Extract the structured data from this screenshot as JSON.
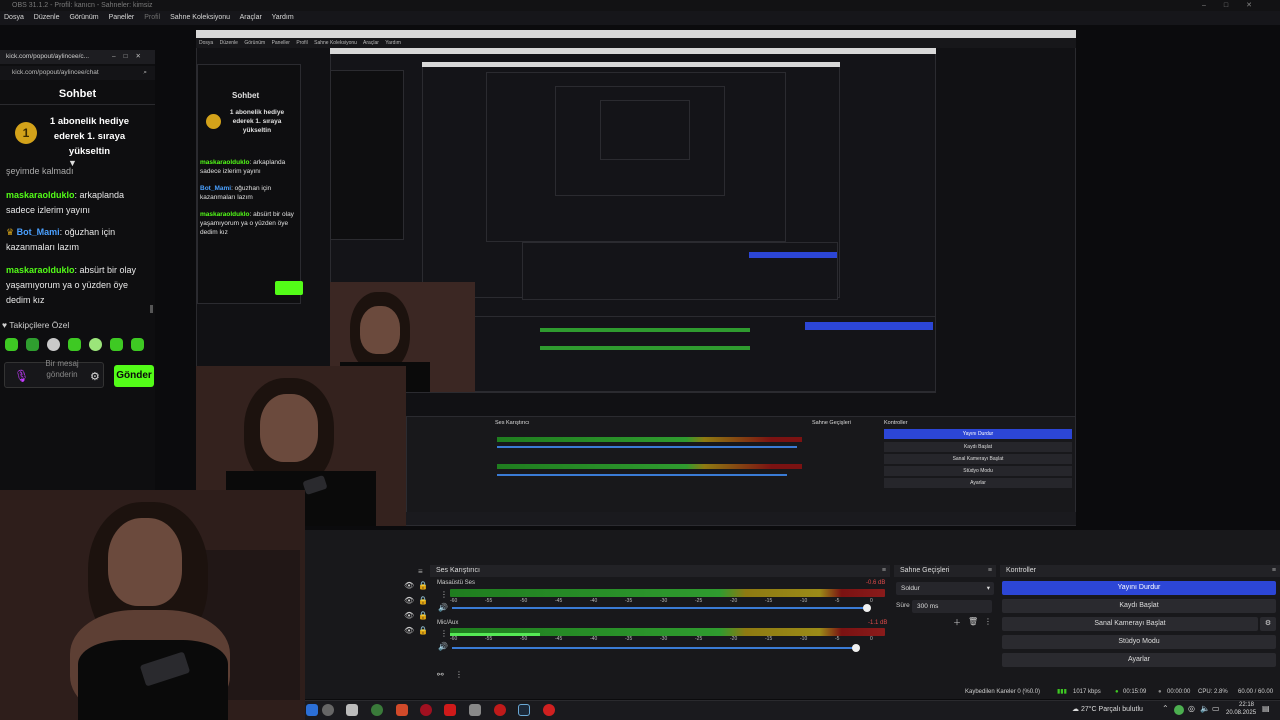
{
  "obs": {
    "title": "OBS 31.1.2 - Profil: kanıcn - Sahneler: kimsiz",
    "menu": [
      "Dosya",
      "Düzenle",
      "Görünüm",
      "Paneller",
      "Profil",
      "Sahne Koleksiyonu",
      "Araçlar",
      "Yardım"
    ]
  },
  "chat": {
    "window_url": "kick.com/popout/aylincee/c...",
    "address": "kick.com/popout/aylincee/chat",
    "title": "Sohbet",
    "badge_number": "1",
    "gift_text": "1 abonelik hediye ederek 1. sıraya yükseltin",
    "cut_line": "şeyimde kalmadı",
    "messages": [
      {
        "user": "maskaraolduklo",
        "text": ": arkaplanda sadece izlerim yayını"
      },
      {
        "user": "Bot_Mami",
        "text": ": oğuzhan için kazanmaları lazım"
      },
      {
        "user": "maskaraolduklo",
        "text": ": absürt bir olay yaşamıyorum ya o yüzden öye dedim kız"
      }
    ],
    "followers_label": "♥ Takipçilere Özel",
    "placeholder": "Bir mesaj gönderin",
    "send_label": "Gönder"
  },
  "preview_menu": [
    "Dosya",
    "Düzenle",
    "Görünüm",
    "Paneller",
    "Profil",
    "Sahne Koleksiyonu",
    "Araçlar",
    "Yardım"
  ],
  "mixer": {
    "header": "Ses Karıştırıcı",
    "sources": [
      {
        "name": "Masaüstü Ses",
        "db": "-0.6 dB"
      },
      {
        "name": "Mic/Aux",
        "db": "-1.1 dB"
      }
    ],
    "ticks": [
      "-60",
      "-55",
      "-50",
      "-45",
      "-40",
      "-35",
      "-30",
      "-25",
      "-20",
      "-15",
      "-10",
      "-5",
      "0"
    ]
  },
  "transitions": {
    "header": "Sahne Geçişleri",
    "type": "Soldur",
    "duration_label": "Süre",
    "duration_value": "300 ms"
  },
  "controls": {
    "header": "Kontroller",
    "buttons": [
      "Yayını Durdur",
      "Kaydı Başlat",
      "Sanal Kamerayı Başlat",
      "Stüdyo Modu",
      "Ayarlar"
    ]
  },
  "status": {
    "dropped": "Kaybedilen Kareler 0 (%0.0)",
    "bitrate": "1017 kbps",
    "stream_time": "00:15:09",
    "rec_time": "00:00:00",
    "cpu": "CPU: 2.8%",
    "fps": "60.00 / 60.00 FPS"
  },
  "tray": {
    "weather": "27°C  Parçalı bulutlu",
    "time": "22:18",
    "date": "20.08.2025"
  },
  "colors": {
    "kick_green": "#53fc18",
    "active_button": "#2c46d6",
    "username_green": "#53fc18",
    "username_blue": "#4aa0ff"
  }
}
